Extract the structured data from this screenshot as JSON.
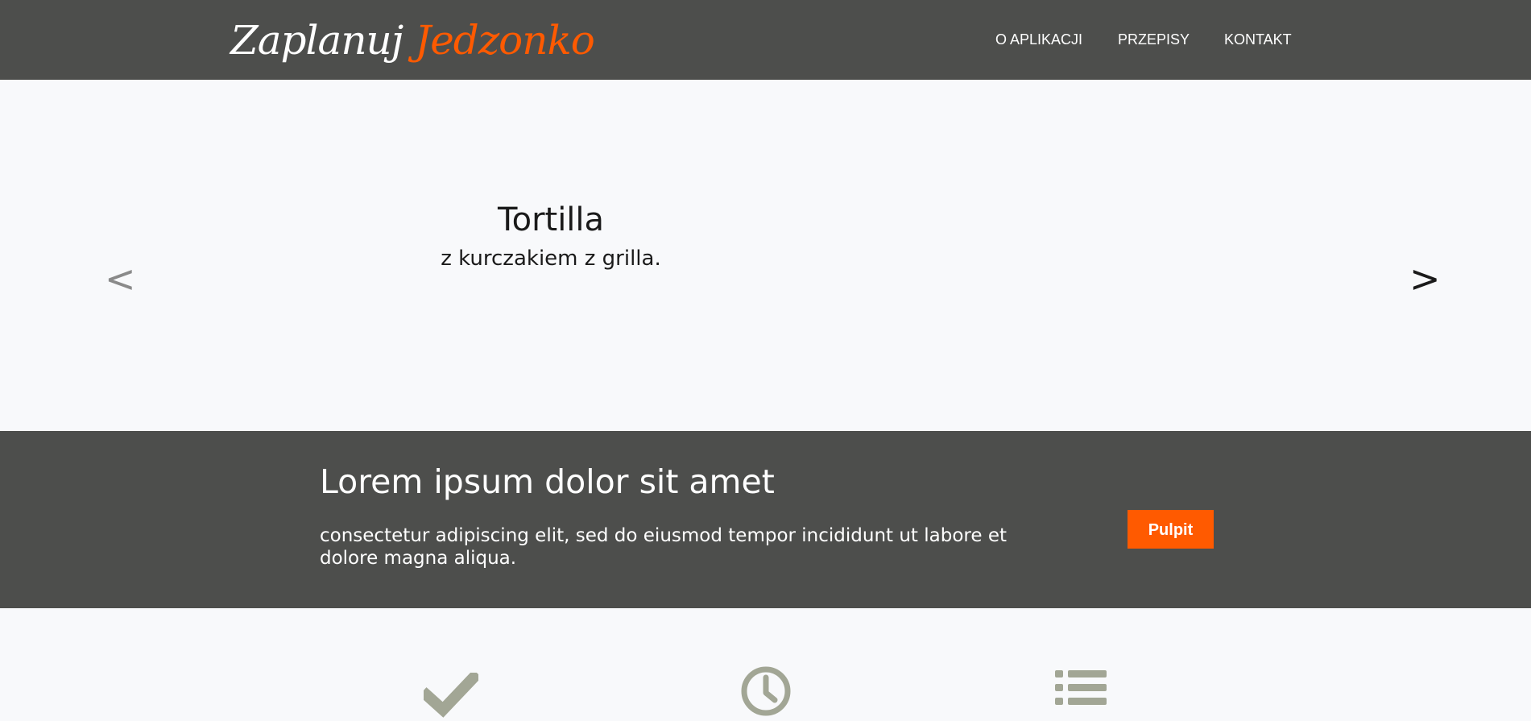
{
  "header": {
    "logo_part1": "Zaplanuj",
    "logo_part2": "Jedzonko",
    "nav": [
      "O APLIKACJI",
      "PRZEPISY",
      "KONTAKT"
    ]
  },
  "carousel": {
    "title": "Tortilla",
    "subtitle": "z kurczakiem z grilla.",
    "prev_label": "<",
    "next_label": ">"
  },
  "promo": {
    "title": "Lorem ipsum dolor sit amet",
    "text": "consectetur adipiscing elit, sed do eiusmod tempor incididunt ut labore et dolore magna aliqua.",
    "button_label": "Pulpit"
  },
  "features": {
    "icons": [
      "check-icon",
      "clock-icon",
      "list-icon"
    ]
  },
  "colors": {
    "dark_band": "#4d4e4c",
    "accent": "#ff5a00",
    "background": "#f8f9fb",
    "icon": "#a2a695"
  }
}
